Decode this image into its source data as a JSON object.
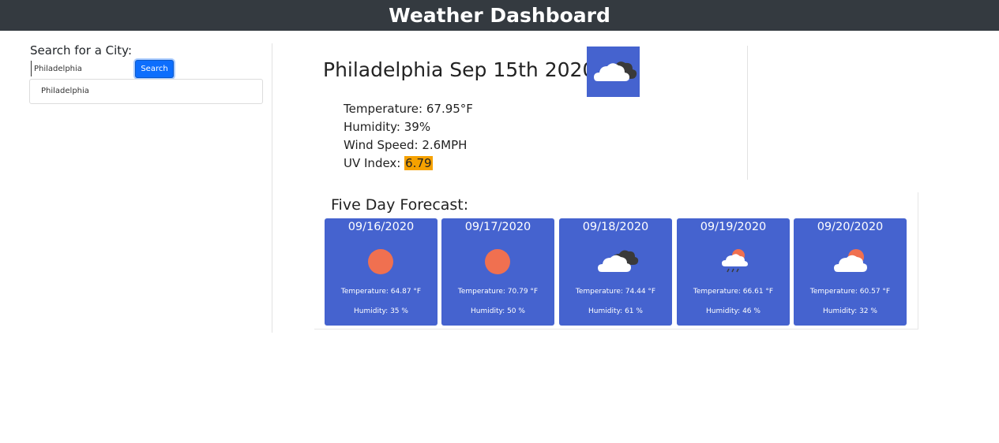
{
  "header": {
    "title": "Weather Dashboard"
  },
  "sidebar": {
    "label": "Search for a City:",
    "search_value": "Philadelphia",
    "search_button": "Search",
    "history": [
      "Philadelphia"
    ]
  },
  "current": {
    "title": "Philadelphia Sep 15th 2020",
    "icon": "cloudy-icon",
    "temperature_label": "Temperature:",
    "temperature_value": "67.95°F",
    "humidity_label": "Humidity:",
    "humidity_value": "39%",
    "wind_label": "Wind Speed:",
    "wind_value": "2.6MPH",
    "uv_label": "UV Index:",
    "uv_value": "6.79"
  },
  "forecast": {
    "title": "Five Day Forecast:",
    "days": [
      {
        "date": "09/16/2020",
        "icon": "sun-icon",
        "temp": "Temperature: 64.87 °F",
        "humidity": "Humidity: 35 %"
      },
      {
        "date": "09/17/2020",
        "icon": "sun-icon",
        "temp": "Temperature: 70.79 °F",
        "humidity": "Humidity: 50 %"
      },
      {
        "date": "09/18/2020",
        "icon": "cloudy-icon",
        "temp": "Temperature: 74.44 °F",
        "humidity": "Humidity: 61 %"
      },
      {
        "date": "09/19/2020",
        "icon": "rain-sun-icon",
        "temp": "Temperature: 66.61 °F",
        "humidity": "Humidity: 46 %"
      },
      {
        "date": "09/20/2020",
        "icon": "partly-cloudy-icon",
        "temp": "Temperature: 60.57 °F",
        "humidity": "Humidity: 32 %"
      }
    ]
  },
  "colors": {
    "header_bg": "#343a40",
    "card_bg": "#4563cf",
    "button_bg": "#0d6efd",
    "uv_high": "#f5a100",
    "sun": "#f07050"
  }
}
